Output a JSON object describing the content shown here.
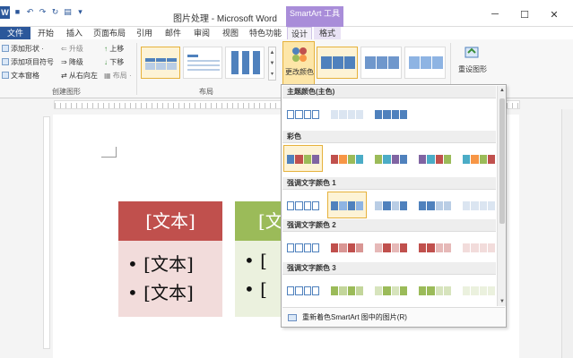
{
  "window": {
    "doc_title": "图片处理 - Microsoft Word",
    "context_group": "SmartArt 工具",
    "app_icon_letter": "W",
    "minimize_icon": "─",
    "maximize_icon": "☐",
    "close_icon": "✕"
  },
  "tabs": [
    {
      "label": "文件",
      "kind": "file"
    },
    {
      "label": "开始"
    },
    {
      "label": "插入"
    },
    {
      "label": "页面布局"
    },
    {
      "label": "引用"
    },
    {
      "label": "邮件"
    },
    {
      "label": "审阅"
    },
    {
      "label": "视图"
    },
    {
      "label": "特色功能"
    },
    {
      "label": "设计",
      "kind": "ctx-active"
    },
    {
      "label": "格式",
      "kind": "ctx"
    }
  ],
  "ribbon": {
    "create_group": {
      "label": "创建图形",
      "add_shape": "添加形状 ·",
      "add_bullet": "添加项目符号",
      "text_pane": "文本窗格",
      "promote": "升级",
      "demote": "降级",
      "rtl": "从右向左",
      "move_up": "上移",
      "move_down": "下移",
      "layout_btn": "布局 ·"
    },
    "layout_group": {
      "label": "布局"
    },
    "change_colors": "更改颜色",
    "reset_graphic": "重设图形"
  },
  "colors_dropdown": {
    "sections": [
      {
        "title": "主题颜色(主色)",
        "rows": [
          [
            "#ffffff",
            "#ffffff",
            "#ffffff",
            "#ffffff"
          ],
          [
            "#dbe5f1",
            "#dbe5f1",
            "#dbe5f1",
            "#dbe5f1"
          ],
          [
            "#4f81bd",
            "#4f81bd",
            "#4f81bd",
            "#4f81bd"
          ]
        ]
      },
      {
        "title": "彩色",
        "rows": [
          [
            "#4f81bd",
            "#c0504d",
            "#9bbb59",
            "#8064a2"
          ],
          [
            "#c0504d",
            "#f79646",
            "#9bbb59",
            "#4bacc6"
          ],
          [
            "#9bbb59",
            "#4bacc6",
            "#8064a2",
            "#4f81bd"
          ],
          [
            "#8064a2",
            "#4bacc6",
            "#c0504d",
            "#9bbb59"
          ],
          [
            "#4bacc6",
            "#f79646",
            "#9bbb59",
            "#c0504d"
          ]
        ]
      },
      {
        "title": "强调文字颜色 1",
        "rows": [
          [
            "#ffffff",
            "#ffffff",
            "#ffffff",
            "#ffffff"
          ],
          [
            "#4f81bd",
            "#8eb4e3",
            "#4f81bd",
            "#8eb4e3"
          ],
          [
            "#b9cde5",
            "#4f81bd",
            "#b9cde5",
            "#4f81bd"
          ],
          [
            "#4f81bd",
            "#4f81bd",
            "#b9cde5",
            "#b9cde5"
          ],
          [
            "#dbe5f1",
            "#dbe5f1",
            "#dbe5f1",
            "#dbe5f1"
          ]
        ]
      },
      {
        "title": "强调文字颜色 2",
        "rows": [
          [
            "#ffffff",
            "#ffffff",
            "#ffffff",
            "#ffffff"
          ],
          [
            "#c0504d",
            "#d99694",
            "#c0504d",
            "#d99694"
          ],
          [
            "#e6b9b8",
            "#c0504d",
            "#e6b9b8",
            "#c0504d"
          ],
          [
            "#c0504d",
            "#c0504d",
            "#e6b9b8",
            "#e6b9b8"
          ],
          [
            "#f2dcdb",
            "#f2dcdb",
            "#f2dcdb",
            "#f2dcdb"
          ]
        ]
      },
      {
        "title": "强调文字颜色 3",
        "rows": [
          [
            "#ffffff",
            "#ffffff",
            "#ffffff",
            "#ffffff"
          ],
          [
            "#9bbb59",
            "#c3d69b",
            "#9bbb59",
            "#c3d69b"
          ],
          [
            "#d7e4bd",
            "#9bbb59",
            "#d7e4bd",
            "#9bbb59"
          ],
          [
            "#9bbb59",
            "#9bbb59",
            "#d7e4bd",
            "#d7e4bd"
          ],
          [
            "#ebf1de",
            "#ebf1de",
            "#ebf1de",
            "#ebf1de"
          ]
        ]
      }
    ],
    "footer": "重新着色SmartArt 图中的图片(R)"
  },
  "document": {
    "shape1": {
      "header": "[文本]",
      "bullets": [
        "• [文本]",
        "• [文本]"
      ],
      "header_color": "#c0504d",
      "body_color": "#f2dcdb"
    },
    "shape2": {
      "header": "[文",
      "bullets": [
        "• [",
        "• ["
      ],
      "header_color": "#9bbb59",
      "body_color": "#ebf1de"
    }
  }
}
